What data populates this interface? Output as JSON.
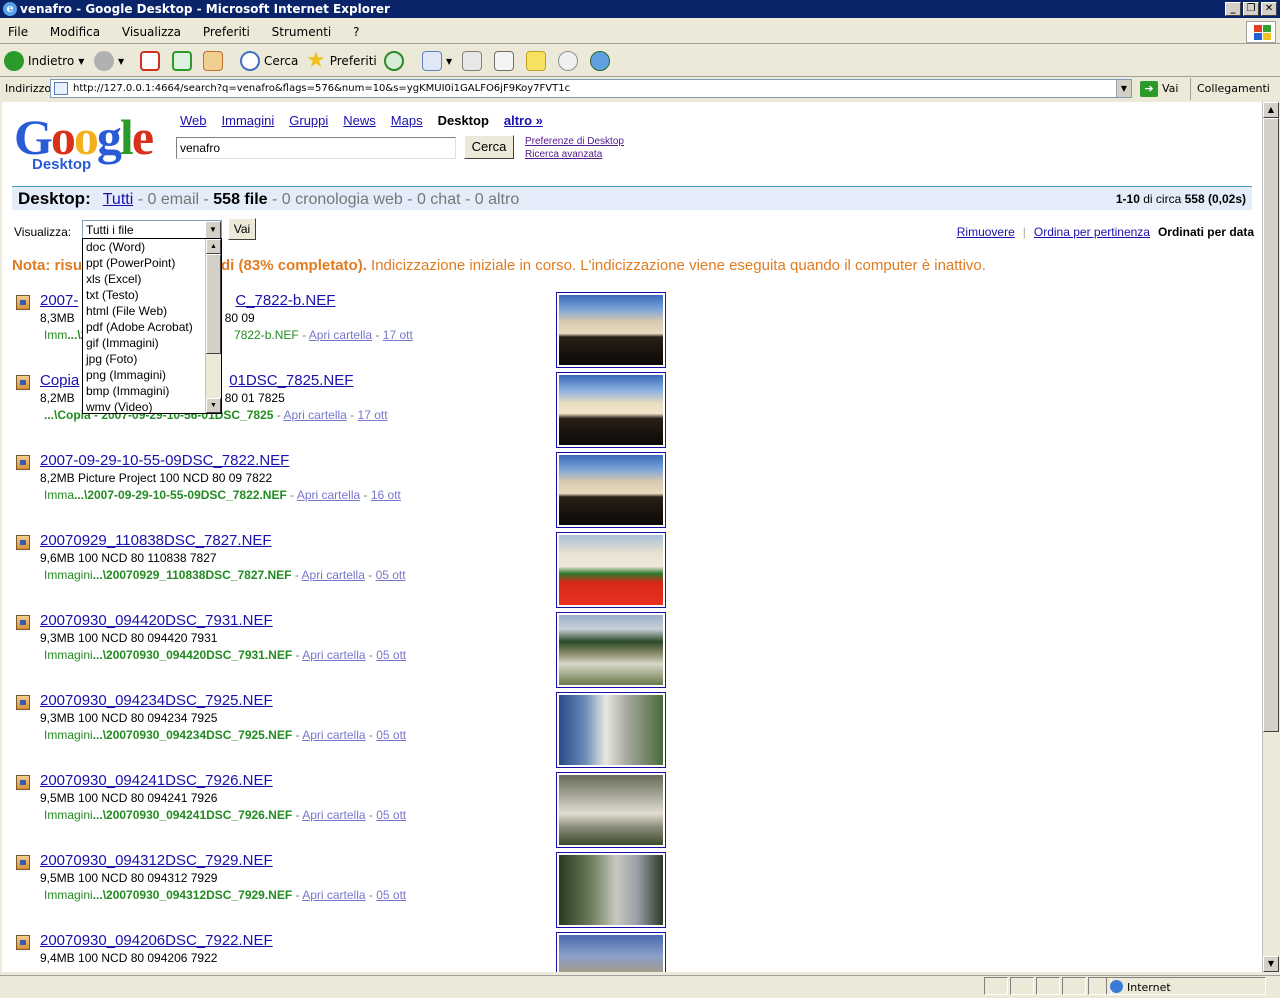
{
  "window": {
    "title": "venafro - Google Desktop - Microsoft Internet Explorer",
    "controls": [
      "_",
      "❐",
      "✕"
    ]
  },
  "menu": [
    "File",
    "Modifica",
    "Visualizza",
    "Preferiti",
    "Strumenti",
    "?"
  ],
  "toolbar": {
    "back": "Indietro",
    "search": "Cerca",
    "favorites": "Preferiti"
  },
  "address": {
    "label": "Indirizzo",
    "url": "http://127.0.0.1:4664/search?q=venafro&flags=576&num=10&s=ygKMUI0i1GALFO6jF9Koy7FVT1c",
    "go": "Vai",
    "links": "Collegamenti"
  },
  "logo": {
    "letters": [
      "G",
      "o",
      "o",
      "g",
      "l",
      "e"
    ],
    "sub": "Desktop"
  },
  "nav": {
    "web": "Web",
    "images": "Immagini",
    "groups": "Gruppi",
    "news": "News",
    "maps": "Maps",
    "desktop": "Desktop",
    "more": "altro »"
  },
  "search": {
    "query": "venafro",
    "button": "Cerca",
    "prefs": "Preferenze di Desktop",
    "advanced": "Ricerca avanzata"
  },
  "category": {
    "label": "Desktop:",
    "all": "Tutti",
    "email": " - 0 email - ",
    "files": "558 file",
    "rest": " - 0 cronologia web - 0 chat - 0 altro",
    "range": "1-10",
    "about": " di circa ",
    "total": "558",
    "time": "(0,02s)"
  },
  "view": {
    "label": "Visualizza:",
    "selected": "Tutti i file",
    "go": "Vai",
    "remove": "Rimuovere",
    "sep": "|",
    "by_relevance": "Ordina per pertinenza",
    "by_date": "Ordinati per data"
  },
  "dropdown_options": [
    "doc (Word)",
    "ppt (PowerPoint)",
    "xls (Excel)",
    "txt (Testo)",
    "html (File Web)",
    "pdf (Adobe Acrobat)",
    "gif (Immagini)",
    "jpg (Foto)",
    "png (Immagini)",
    "bmp (Immagini)",
    "wmv (Video)"
  ],
  "nota": {
    "bold": "Nota: risu",
    "bold2": "di (83% completato).",
    "text": " Indicizzazione iniziale in corso. L'indicizzazione viene eseguita quando il computer è inattivo."
  },
  "results": [
    {
      "title": "2007-",
      "title2": "C_7822-b.NEF",
      "meta": "8,3MB",
      "meta2": "80 09",
      "path_pre": "Imm",
      "path": "...\\20",
      "path2": "7822-b.NEF",
      "open": "Apri cartella",
      "date": "17 ott"
    },
    {
      "title": "Copia",
      "title2": "01DSC_7825.NEF",
      "meta": "8,2MB",
      "meta2": "80 01 7825",
      "path_pre": "",
      "path": "...\\Copia - 2007-09-29-10-56-01DSC_7825",
      "path2": "",
      "open": "Apri cartella",
      "date": "17 ott"
    },
    {
      "title": "2007-09-29-10-55-09DSC_7822.NEF",
      "title2": "",
      "meta": "8,2MB Picture Project 100 NCD 80 09 7822",
      "meta2": "",
      "path_pre": "Imma",
      "path": "...\\2007-09-29-10-55-09DSC_7822.NEF",
      "path2": "",
      "open": "Apri cartella",
      "date": "16 ott"
    },
    {
      "title": "20070929_110838DSC_7827.NEF",
      "title2": "",
      "meta": "9,6MB 100 NCD 80 110838 7827",
      "meta2": "",
      "path_pre": "Immagini",
      "path": "...\\20070929_110838DSC_7827.NEF",
      "path2": "",
      "open": "Apri cartella",
      "date": "05 ott"
    },
    {
      "title": "20070930_094420DSC_7931.NEF",
      "title2": "",
      "meta": "9,3MB 100 NCD 80 094420 7931",
      "meta2": "",
      "path_pre": "Immagini",
      "path": "...\\20070930_094420DSC_7931.NEF",
      "path2": "",
      "open": "Apri cartella",
      "date": "05 ott"
    },
    {
      "title": "20070930_094234DSC_7925.NEF",
      "title2": "",
      "meta": "9,3MB 100 NCD 80 094234 7925",
      "meta2": "",
      "path_pre": "Immagini",
      "path": "...\\20070930_094234DSC_7925.NEF",
      "path2": "",
      "open": "Apri cartella",
      "date": "05 ott"
    },
    {
      "title": "20070930_094241DSC_7926.NEF",
      "title2": "",
      "meta": "9,5MB 100 NCD 80 094241 7926",
      "meta2": "",
      "path_pre": "Immagini",
      "path": "...\\20070930_094241DSC_7926.NEF",
      "path2": "",
      "open": "Apri cartella",
      "date": "05 ott"
    },
    {
      "title": "20070930_094312DSC_7929.NEF",
      "title2": "",
      "meta": "9,5MB 100 NCD 80 094312 7929",
      "meta2": "",
      "path_pre": "Immagini",
      "path": "...\\20070930_094312DSC_7929.NEF",
      "path2": "",
      "open": "Apri cartella",
      "date": "05 ott"
    },
    {
      "title": "20070930_094206DSC_7922.NEF",
      "title2": "",
      "meta": "9,4MB 100 NCD 80 094206 7922",
      "meta2": "",
      "path_pre": "",
      "path": "",
      "path2": "",
      "open": "",
      "date": ""
    }
  ],
  "status": {
    "zone": "Internet"
  }
}
